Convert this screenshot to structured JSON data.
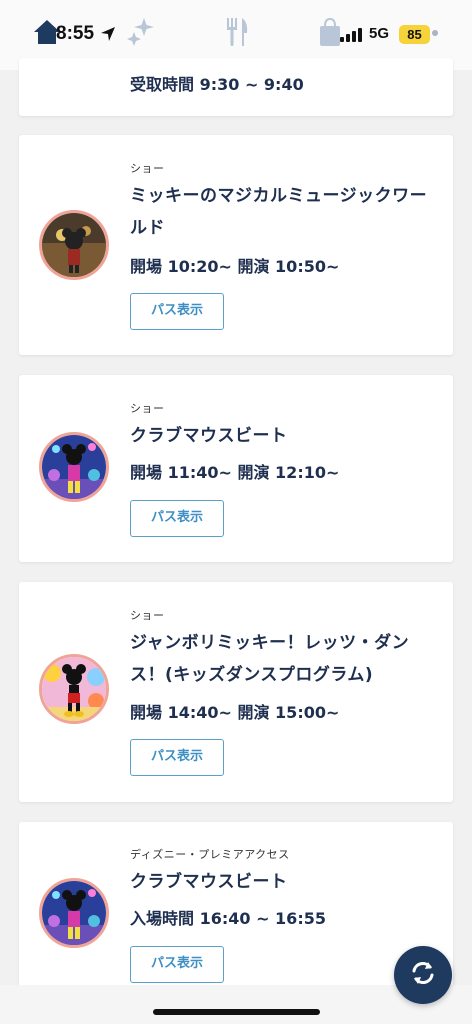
{
  "status_bar": {
    "time": "8:55",
    "network": "5G",
    "battery": "85"
  },
  "top_card": {
    "time_line": "受取時間 9:30 ~ 9:40"
  },
  "cards": [
    {
      "category": "ショー",
      "title": "ミッキーのマジカルミュージックワールド",
      "time_line": "開場 10:20~ 開演 10:50~",
      "button_label": "パス表示"
    },
    {
      "category": "ショー",
      "title": "クラブマウスビート",
      "time_line": "開場 11:40~ 開演 12:10~",
      "button_label": "パス表示"
    },
    {
      "category": "ショー",
      "title": "ジャンボリミッキー！レッツ・ダンス！(キッズダンスプログラム)",
      "time_line": "開場 14:40~ 開演 15:00~",
      "button_label": "パス表示"
    },
    {
      "category": "ディズニー・プレミアアクセス",
      "title": "クラブマウスビート",
      "time_line": "入場時間 16:40 ~ 16:55",
      "button_label": "パス表示"
    }
  ],
  "icons": {
    "home": "home-icon",
    "stars": "stars-icon",
    "restaurant": "fork-knife-icon",
    "shop": "shopping-bag-icon",
    "refresh": "refresh-icon"
  },
  "colors": {
    "text_primary": "#1e2f4f",
    "button_border": "#5aa0c8",
    "avatar_ring": "#f0a497",
    "fab_bg": "#1f3a5f",
    "battery": "#f6d23b"
  }
}
